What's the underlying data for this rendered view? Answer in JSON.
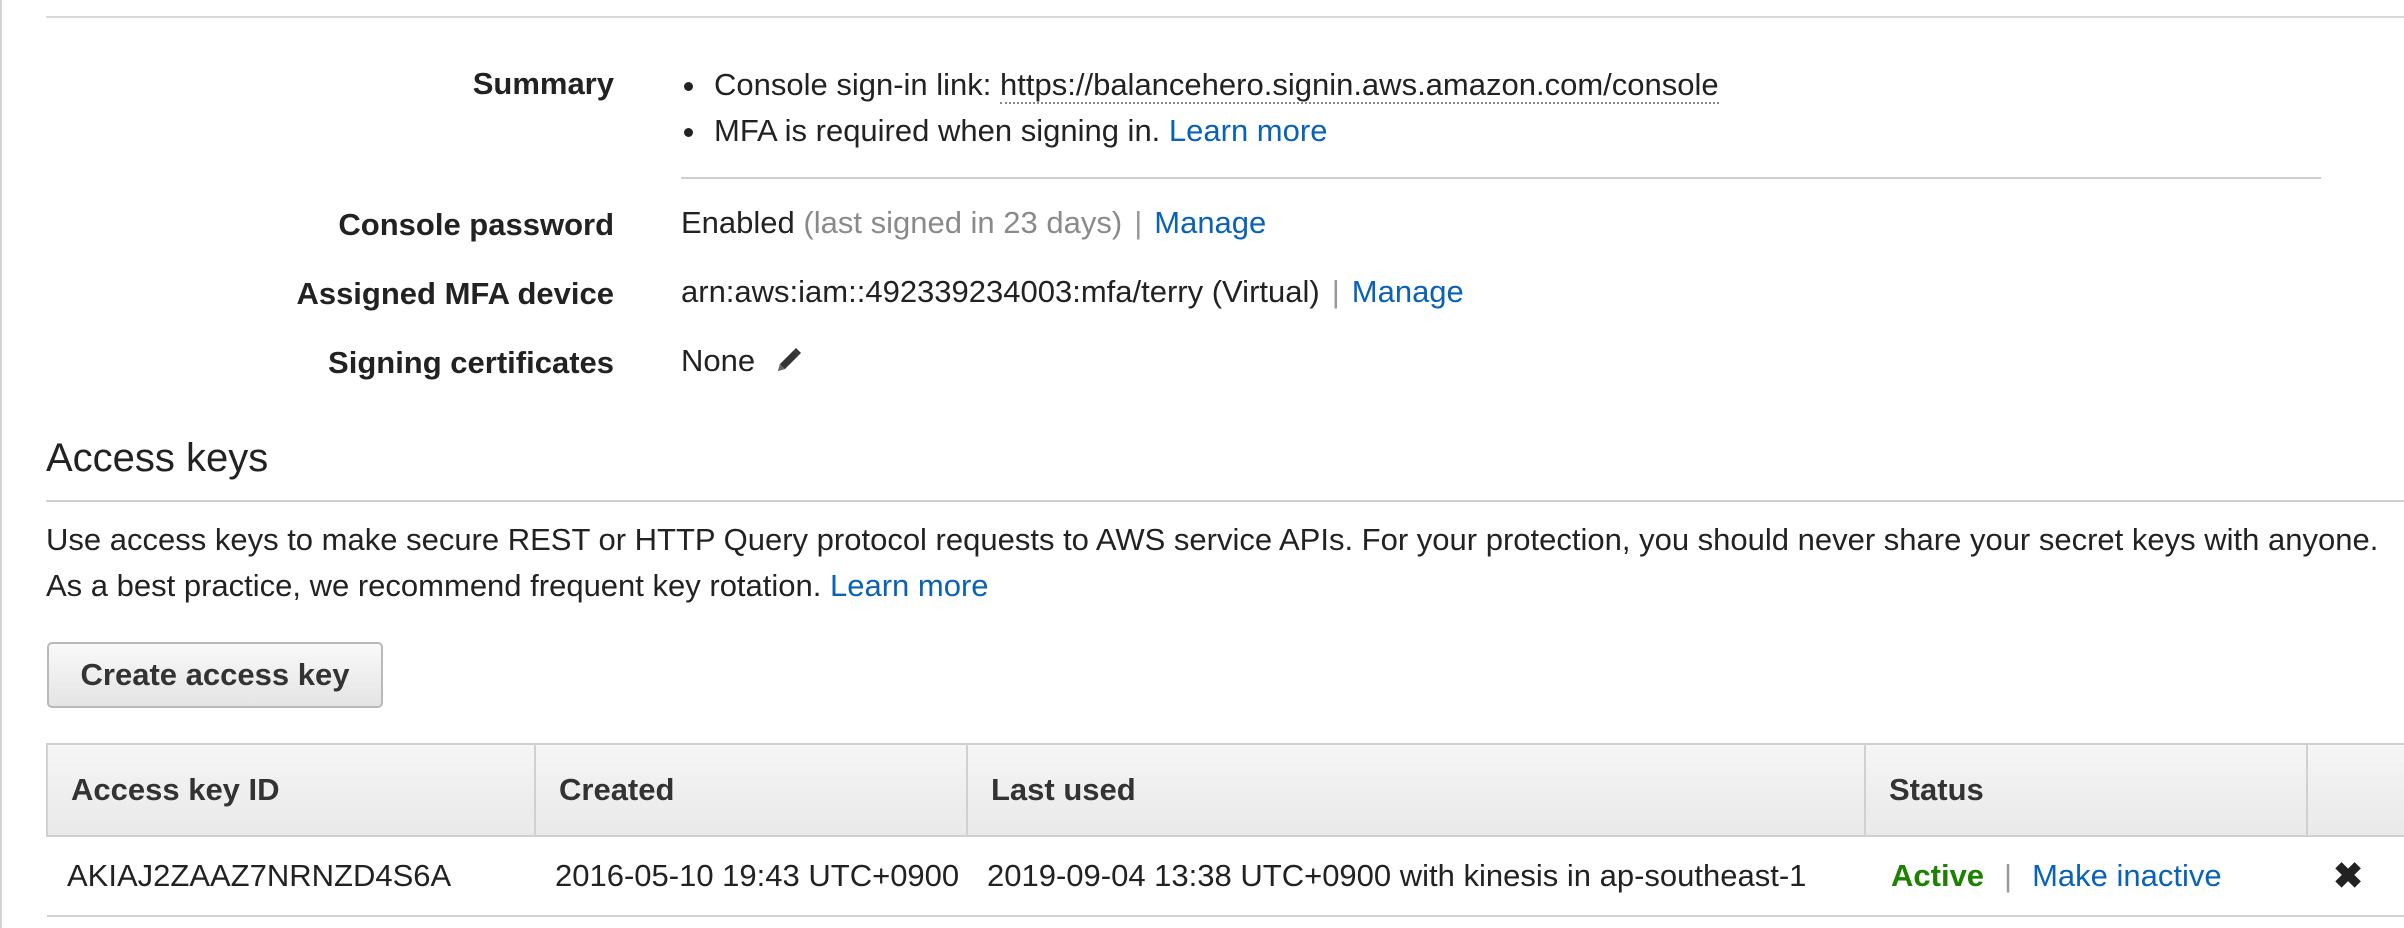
{
  "summary": {
    "label": "Summary",
    "signin_prefix": "Console sign-in link: ",
    "signin_link": "https://balancehero.signin.aws.amazon.com/console",
    "mfa_text": "MFA is required when signing in. ",
    "mfa_learn_more": "Learn more"
  },
  "console_password": {
    "label": "Console password",
    "value": "Enabled",
    "last_signed": "(last signed in 23 days)",
    "separator": "|",
    "manage": "Manage"
  },
  "mfa_device": {
    "label": "Assigned MFA device",
    "value": "arn:aws:iam::492339234003:mfa/terry (Virtual)",
    "separator": "|",
    "manage": "Manage"
  },
  "signing_certificates": {
    "label": "Signing certificates",
    "value": "None",
    "edit_icon": "pencil-icon"
  },
  "access_keys": {
    "title": "Access keys",
    "description": "Use access keys to make secure REST or HTTP Query protocol requests to AWS service APIs. For your protection, you should never share your secret keys with anyone. As a best practice, we recommend frequent key rotation. ",
    "learn_more": "Learn more",
    "create_button": "Create access key",
    "columns": [
      "Access key ID",
      "Created",
      "Last used",
      "Status",
      ""
    ],
    "rows": [
      {
        "id": "AKIAJ2ZAAZ7NRNZD4S6A",
        "created": "2016-05-10 19:43 UTC+0900",
        "last_used": "2019-09-04 13:38 UTC+0900 with kinesis in ap-southeast-1",
        "status": "Active",
        "separator": "|",
        "action": "Make inactive",
        "delete_icon": "close-icon",
        "delete_glyph": "✖"
      }
    ]
  },
  "colors": {
    "link": "#0a62b8",
    "active": "#1d8102",
    "muted": "#8a8a8a"
  }
}
